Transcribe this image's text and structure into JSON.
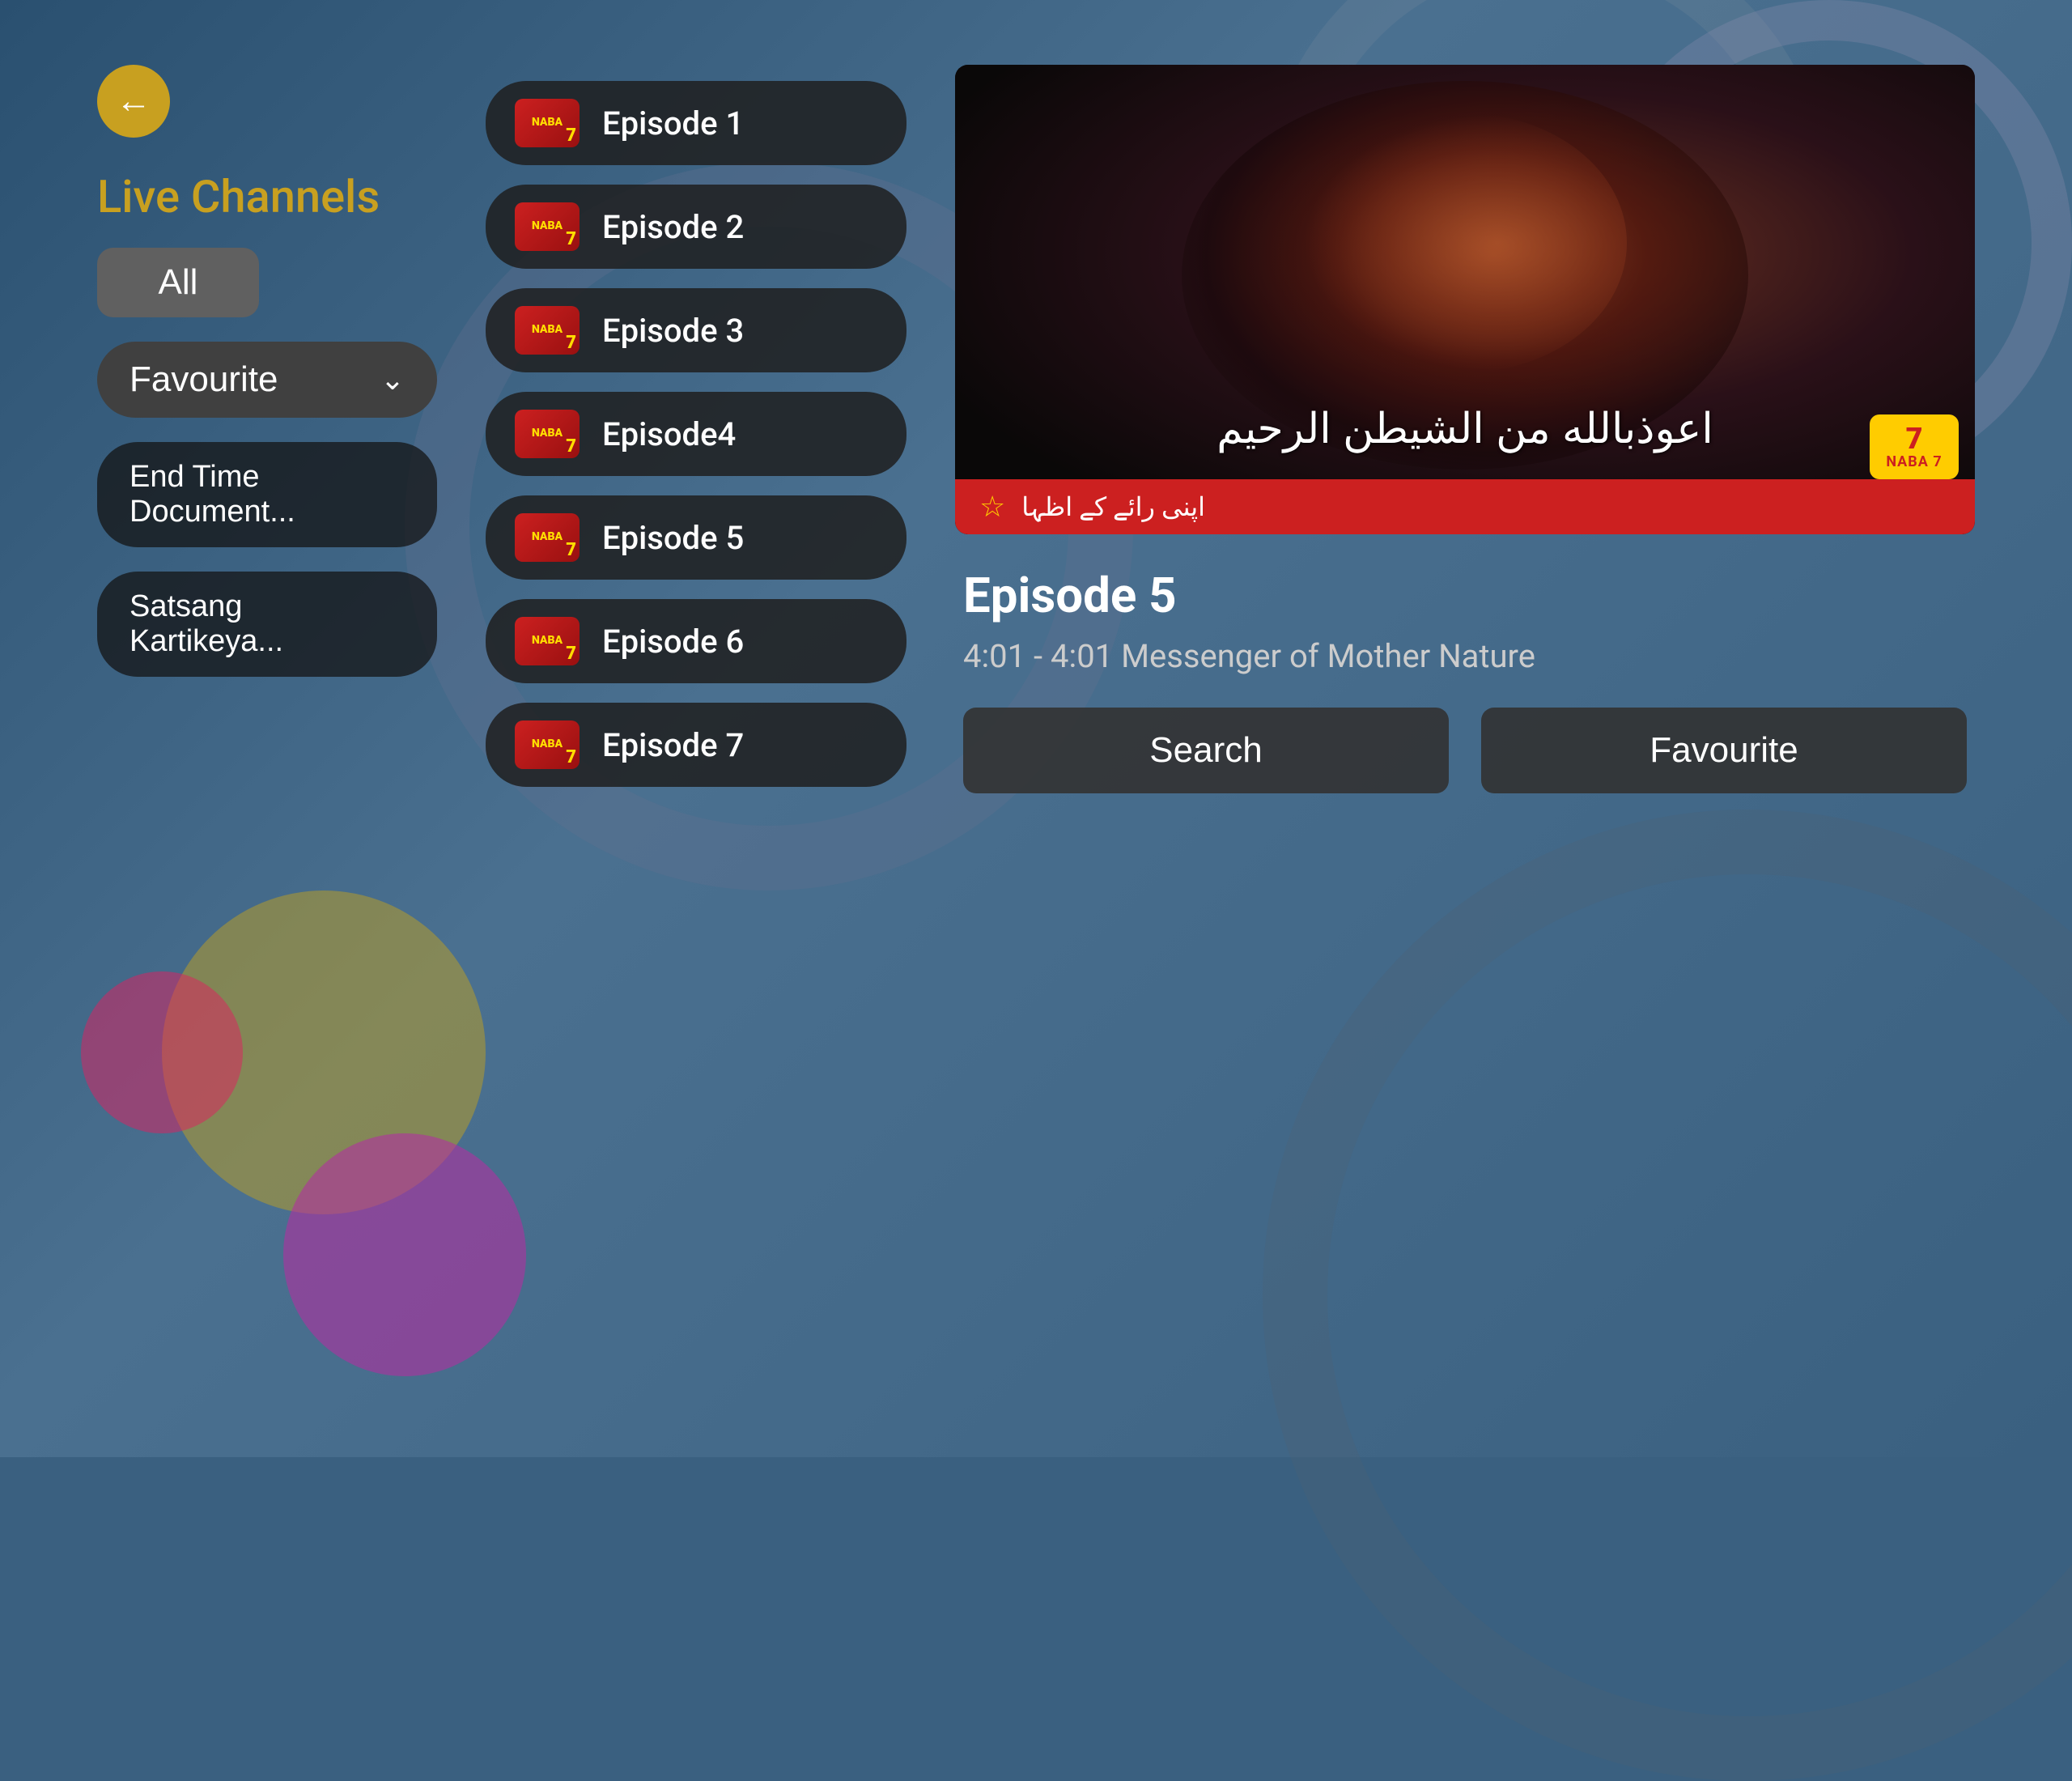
{
  "background": {
    "color": "#3a6080"
  },
  "sidebar": {
    "back_label": "←",
    "title": "Live Channels",
    "all_label": "All",
    "favourite_label": "Favourite",
    "chevron": "⌄",
    "channels": [
      {
        "id": "end-time",
        "label": "End Time Document..."
      },
      {
        "id": "satsang",
        "label": "Satsang Kartikeya..."
      }
    ]
  },
  "episodes": [
    {
      "id": "ep1",
      "label": "Episode 1",
      "thumb_text": "NABA",
      "thumb_num": "7"
    },
    {
      "id": "ep2",
      "label": "Episode 2",
      "thumb_text": "NABA",
      "thumb_num": "7"
    },
    {
      "id": "ep3",
      "label": "Episode 3",
      "thumb_text": "NABA",
      "thumb_num": "7"
    },
    {
      "id": "ep4",
      "label": "Episode4",
      "thumb_text": "NABA",
      "thumb_num": "7"
    },
    {
      "id": "ep5",
      "label": "Episode 5",
      "thumb_text": "NABA",
      "thumb_num": "7"
    },
    {
      "id": "ep6",
      "label": "Episode 6",
      "thumb_text": "NABA",
      "thumb_num": "7"
    },
    {
      "id": "ep7",
      "label": "Episode 7",
      "thumb_text": "NABA",
      "thumb_num": "7"
    }
  ],
  "detail": {
    "video": {
      "arabic_text": "اعوذبالله من الشيطن الرحيم",
      "ticker_star": "☆",
      "ticker_text": "اپنی رائے کے اظہا",
      "logo_number": "7",
      "logo_text": "NABA 7"
    },
    "episode_title": "Episode 5",
    "episode_subtitle": "4:01 - 4:01 Messenger of Mother Nature",
    "buttons": {
      "search_label": "Search",
      "favourite_label": "Favourite"
    }
  }
}
